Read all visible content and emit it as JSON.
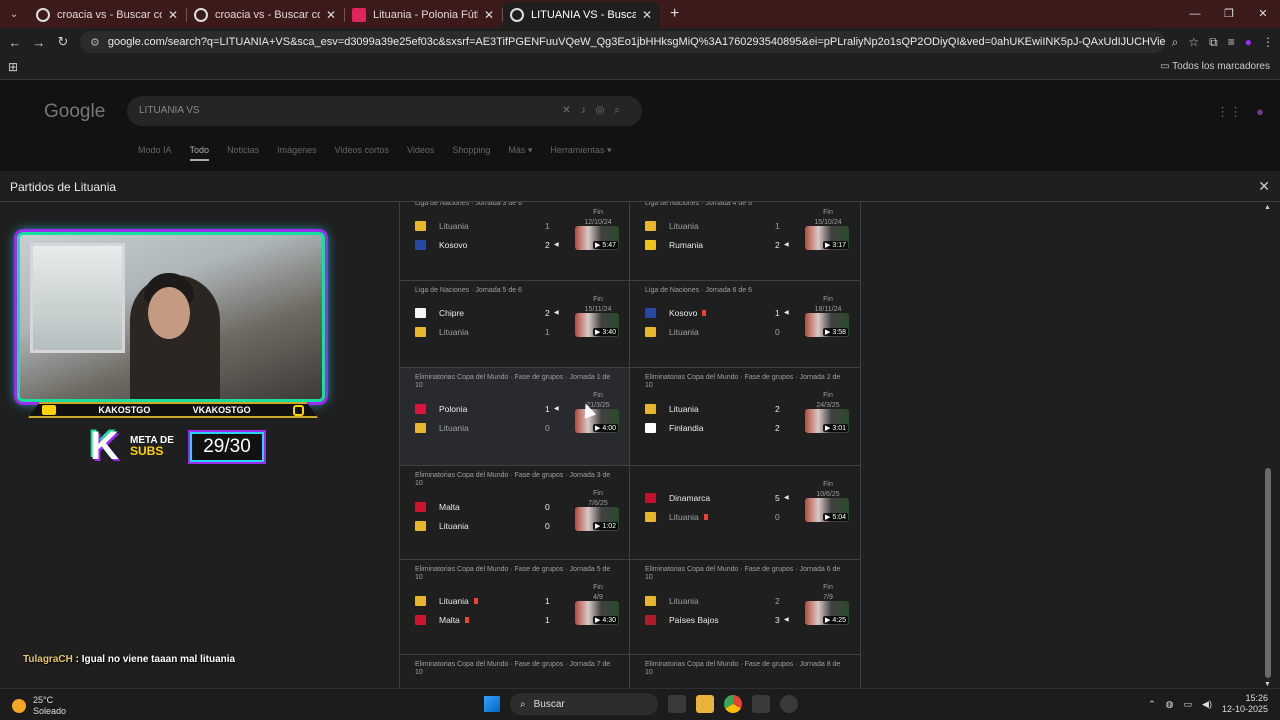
{
  "browser": {
    "tabs": [
      {
        "title": "croacia vs - Buscar con Google",
        "icon": "google-icon",
        "active": false
      },
      {
        "title": "croacia vs - Buscar con Google",
        "icon": "google-icon",
        "active": false
      },
      {
        "title": "Lituania - Polonia Fútbol Cuota",
        "icon": "betting-site-icon",
        "active": false
      },
      {
        "title": "LITUANIA VS - Buscar con Goog",
        "icon": "google-icon",
        "active": true
      }
    ],
    "url": "google.com/search?q=LITUANIA+VS&sca_esv=d3099a39e25ef03c&sxsrf=AE3TifPGENFuuVQeW_Qg3Eo1jbHHksgMiQ%3A1760293540895&ei=pPLraliyNp2o1sQP2ODiyQI&ved=0ahUKEwiINK5pJ-QAxUdIJUCHVieOCkQ4dUDCBE&uact=5&oq=...",
    "bookmarks_label": "Todos los marcadores"
  },
  "google": {
    "logo": "Google",
    "query": "LITUANIA VS",
    "nav": [
      "Modo IA",
      "Todo",
      "Noticias",
      "Imágenes",
      "Videos cortos",
      "Videos",
      "Shopping",
      "Más ▾",
      "Herramientas ▾"
    ],
    "active_nav": "Todo"
  },
  "panel": {
    "title": "Partidos de Lituania",
    "matches": [
      {
        "league": "Liga de Naciones · Jornada 3 de 6",
        "status": "Fin",
        "date": "12/10/24",
        "duration": "5:47",
        "home": {
          "name": "Lituania",
          "score": "1",
          "flag": "#e9b52a",
          "win": false,
          "red": false
        },
        "away": {
          "name": "Kosovo",
          "score": "2",
          "flag": "#244aa5",
          "win": true,
          "red": false
        }
      },
      {
        "league": "Liga de Naciones · Jornada 4 de 6",
        "status": "Fin",
        "date": "15/10/24",
        "duration": "3:17",
        "home": {
          "name": "Lituania",
          "score": "1",
          "flag": "#e9b52a",
          "win": false,
          "red": false
        },
        "away": {
          "name": "Rumania",
          "score": "2",
          "flag": "#f0c419",
          "win": true,
          "red": false
        }
      },
      {
        "league": "Liga de Naciones · Jornada 5 de 6",
        "status": "Fin",
        "date": "15/11/24",
        "duration": "3:40",
        "home": {
          "name": "Chipre",
          "score": "2",
          "flag": "#f5f5f5",
          "win": true,
          "red": false
        },
        "away": {
          "name": "Lituania",
          "score": "1",
          "flag": "#e9b52a",
          "win": false,
          "red": false
        }
      },
      {
        "league": "Liga de Naciones · Jornada 6 de 6",
        "status": "Fin",
        "date": "18/11/24",
        "duration": "3:58",
        "home": {
          "name": "Kosovo",
          "score": "1",
          "flag": "#244aa5",
          "win": true,
          "red": true
        },
        "away": {
          "name": "Lituania",
          "score": "0",
          "flag": "#e9b52a",
          "win": false,
          "red": false
        }
      },
      {
        "league": "Eliminatorias Copa del Mundo · Fase de grupos · Jornada 1 de 10",
        "status": "Fin",
        "date": "21/3/25",
        "duration": "4:00",
        "home": {
          "name": "Polonia",
          "score": "1",
          "flag": "#dc143c",
          "win": true,
          "red": false
        },
        "away": {
          "name": "Lituania",
          "score": "0",
          "flag": "#e9b52a",
          "win": false,
          "red": false
        }
      },
      {
        "league": "Eliminatorias Copa del Mundo · Fase de grupos · Jornada 2 de 10",
        "status": "Fin",
        "date": "24/3/25",
        "duration": "3:01",
        "home": {
          "name": "Lituania",
          "score": "2",
          "flag": "#e9b52a",
          "win": true,
          "red": false
        },
        "away": {
          "name": "Finlandia",
          "score": "2",
          "flag": "#ffffff",
          "win": true,
          "red": false
        }
      },
      {
        "league": "Eliminatorias Copa del Mundo · Fase de grupos · Jornada 3 de 10",
        "status": "Fin",
        "date": "7/6/25",
        "duration": "1:02",
        "home": {
          "name": "Malta",
          "score": "0",
          "flag": "#cf142b",
          "win": true,
          "red": false
        },
        "away": {
          "name": "Lituania",
          "score": "0",
          "flag": "#e9b52a",
          "win": true,
          "red": false
        }
      },
      {
        "league": "",
        "status": "Fin",
        "date": "10/6/25",
        "duration": "5:04",
        "home": {
          "name": "Dinamarca",
          "score": "5",
          "flag": "#c8102e",
          "win": true,
          "red": false
        },
        "away": {
          "name": "Lituania",
          "score": "0",
          "flag": "#e9b52a",
          "win": false,
          "red": true
        }
      },
      {
        "league": "Eliminatorias Copa del Mundo · Fase de grupos · Jornada 5 de 10",
        "status": "Fin",
        "date": "4/9",
        "duration": "4:30",
        "home": {
          "name": "Lituania",
          "score": "1",
          "flag": "#e9b52a",
          "win": true,
          "red": true
        },
        "away": {
          "name": "Malta",
          "score": "1",
          "flag": "#cf142b",
          "win": true,
          "red": true
        }
      },
      {
        "league": "Eliminatorias Copa del Mundo · Fase de grupos · Jornada 6 de 10",
        "status": "Fin",
        "date": "7/9",
        "duration": "4:25",
        "home": {
          "name": "Lituania",
          "score": "2",
          "flag": "#e9b52a",
          "win": false,
          "red": false
        },
        "away": {
          "name": "Países Bajos",
          "score": "3",
          "flag": "#ae1c28",
          "win": true,
          "red": false
        }
      },
      {
        "league": "Eliminatorias Copa del Mundo · Fase de grupos · Jornada 7 de 10",
        "status": "",
        "date": "",
        "duration": "",
        "home": {
          "name": "",
          "score": "",
          "flag": "#1f1f1f",
          "win": false,
          "red": false
        },
        "away": {
          "name": "",
          "score": "",
          "flag": "#1f1f1f",
          "win": false,
          "red": false
        }
      },
      {
        "league": "Eliminatorias Copa del Mundo · Fase de grupos · Jornada 8 de 10",
        "status": "",
        "date": "",
        "duration": "",
        "home": {
          "name": "",
          "score": "",
          "flag": "#1f1f1f",
          "win": false,
          "red": false
        },
        "away": {
          "name": "",
          "score": "",
          "flag": "#1f1f1f",
          "win": false,
          "red": false
        }
      }
    ]
  },
  "stream": {
    "youtube_handle": "KAKOSTGO",
    "other_handle": "VKAKOSTGO",
    "meta_label_1": "META DE",
    "meta_label_2": "SUBS",
    "sub_count": "29/30",
    "chat_user": "TulagraCH",
    "chat_message": ": Igual no viene taaan mal lituania"
  },
  "taskbar": {
    "temperature": "25°C",
    "weather": "Soleado",
    "search_label": "Buscar",
    "time": "15:26",
    "date": "12-10-2025"
  }
}
